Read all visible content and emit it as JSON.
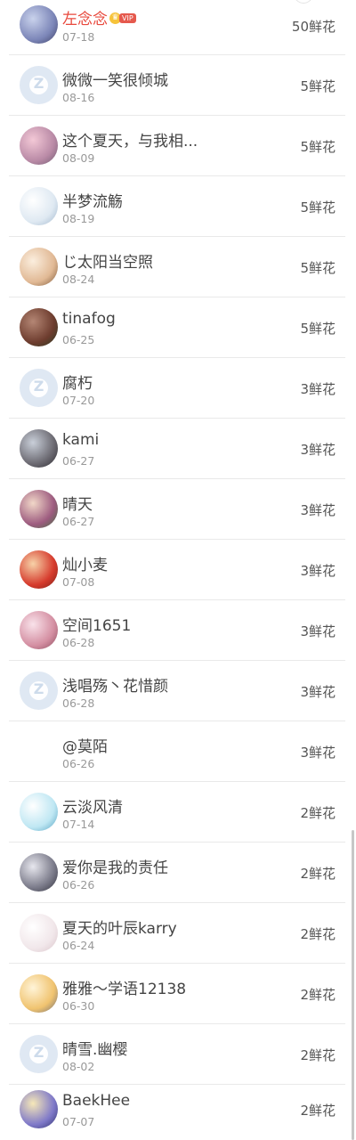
{
  "rows": [
    {
      "name": "左念念",
      "date": "07-18",
      "flowers": "50鲜花",
      "vip": true
    },
    {
      "name": "微微一笑很倾城",
      "date": "08-16",
      "flowers": "5鲜花"
    },
    {
      "name": "这个夏天，与我相...",
      "date": "08-09",
      "flowers": "5鲜花"
    },
    {
      "name": "半梦流觞",
      "date": "08-19",
      "flowers": "5鲜花"
    },
    {
      "name": "じ太阳当空照",
      "date": "08-24",
      "flowers": "5鲜花"
    },
    {
      "name": "tinafog",
      "date": "06-25",
      "flowers": "5鲜花"
    },
    {
      "name": "腐朽",
      "date": "07-20",
      "flowers": "3鲜花"
    },
    {
      "name": "kami",
      "date": "06-27",
      "flowers": "3鲜花"
    },
    {
      "name": "晴天",
      "date": "06-27",
      "flowers": "3鲜花"
    },
    {
      "name": "灿小麦",
      "date": "07-08",
      "flowers": "3鲜花"
    },
    {
      "name": "空间1651",
      "date": "06-28",
      "flowers": "3鲜花"
    },
    {
      "name": "浅唱殇丶花惜颜",
      "date": "06-28",
      "flowers": "3鲜花"
    },
    {
      "name": "@莫陌",
      "date": "06-26",
      "flowers": "3鲜花"
    },
    {
      "name": "云淡风清",
      "date": "07-14",
      "flowers": "2鲜花"
    },
    {
      "name": "爱你是我的责任",
      "date": "06-26",
      "flowers": "2鲜花"
    },
    {
      "name": "夏天的叶辰karry",
      "date": "06-24",
      "flowers": "2鲜花"
    },
    {
      "name": "雅雅～学语12138",
      "date": "06-30",
      "flowers": "2鲜花"
    },
    {
      "name": "晴雪.幽樱",
      "date": "08-02",
      "flowers": "2鲜花"
    },
    {
      "name": "BaekHee",
      "date": "07-07",
      "flowers": "2鲜花"
    }
  ],
  "vip_badge": {
    "crown": "♛",
    "label": "VIP"
  }
}
